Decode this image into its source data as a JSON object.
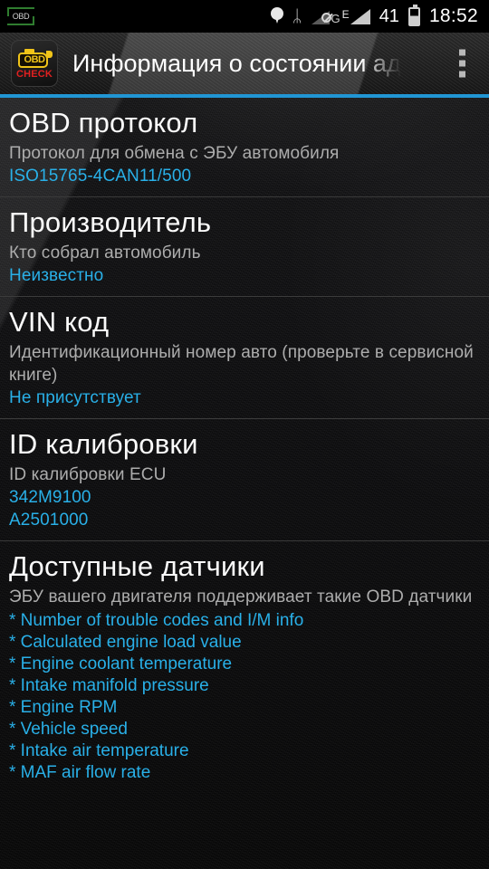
{
  "status_bar": {
    "notification_icon": "obd-notification-icon",
    "notification_label": "OBD",
    "icons": [
      "location-pin-icon",
      "bluetooth-icon",
      "mobile-data-blocked-icon",
      "edge-signal-icon",
      "battery-icon"
    ],
    "network_type_g": "G",
    "network_type_e": "E",
    "battery_percent": "41",
    "time": "18:52"
  },
  "action_bar": {
    "app_icon": "obd-check-engine-icon",
    "app_icon_text": "OBD",
    "app_icon_subtext": "CHECK",
    "title": "Информация о состоянии ад",
    "overflow_menu": "overflow-menu-icon",
    "accent_color": "#2196d4"
  },
  "colors": {
    "value_blue": "#29b0e8",
    "title_white": "#fafafa",
    "desc_gray": "#adadad",
    "background": "#111113"
  },
  "sections": [
    {
      "title": "OBD протокол",
      "description": "Протокол для обмена с ЭБУ автомобиля",
      "values": [
        "ISO15765-4CAN11/500"
      ]
    },
    {
      "title": "Производитель",
      "description": "Кто собрал автомобиль",
      "values": [
        "Неизвестно"
      ]
    },
    {
      "title": "VIN код",
      "description": "Идентификационный номер авто (проверьте в сервисной книге)",
      "values": [
        "Не присутствует"
      ]
    },
    {
      "title": "ID калибровки",
      "description": "ID калибровки ECU",
      "values": [
        "342M9100",
        "A2501000"
      ]
    },
    {
      "title": "Доступные датчики",
      "description": "ЭБУ вашего двигателя поддерживает такие OBD датчики",
      "values": [
        "* Number of trouble codes and I/M info",
        "* Calculated engine load value",
        "* Engine coolant temperature",
        "* Intake manifold pressure",
        "* Engine RPM",
        "* Vehicle speed",
        "* Intake air temperature",
        "* MAF air flow rate"
      ]
    }
  ]
}
